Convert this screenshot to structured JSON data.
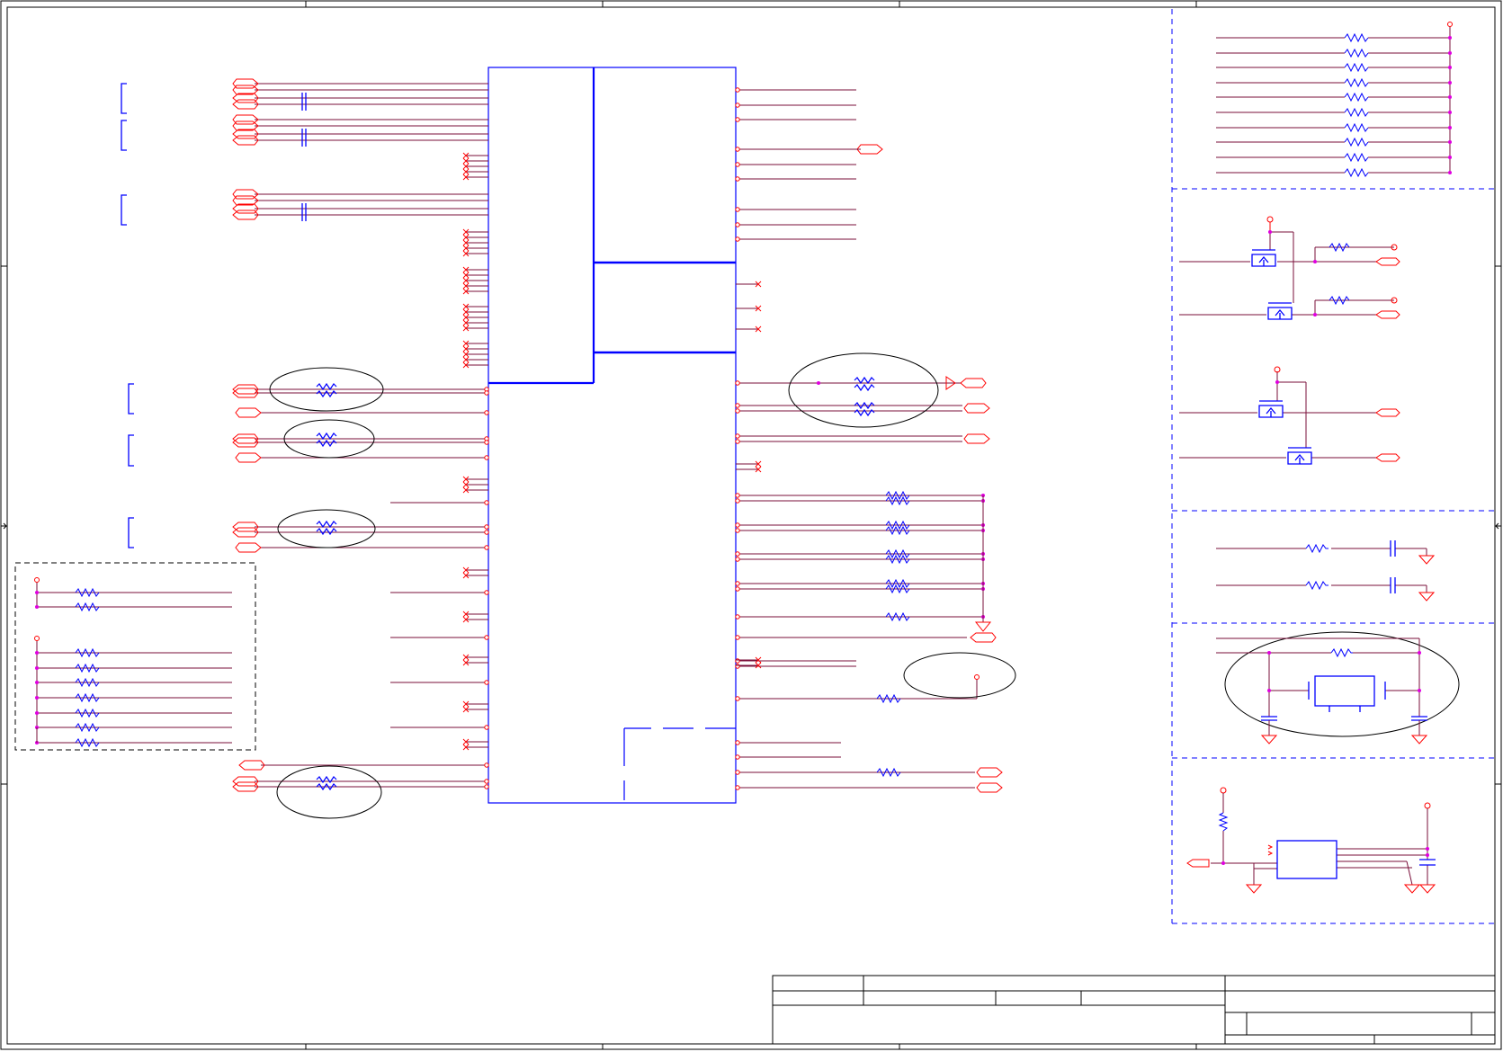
{
  "sheet": {
    "background": "#ffffff",
    "frame_color": "#000000",
    "wire_color": "#7a0f3a",
    "net_color": "#ff0000",
    "part_color": "#0000ff",
    "junction_color": "#e000e0",
    "box_dash_color": "#0000ff",
    "annotation_color": "#000000"
  },
  "symbols": {
    "resistor": "resistor-icon",
    "capacitor": "capacitor-icon",
    "mosfet": "mosfet-icon",
    "ground": "ground-icon",
    "net_port": "port-icon",
    "no_connect": "no-connect-icon",
    "crystal": "crystal-icon"
  },
  "title_block": {
    "cells": [
      "",
      "",
      "",
      "",
      "",
      "",
      "",
      "",
      ""
    ]
  }
}
